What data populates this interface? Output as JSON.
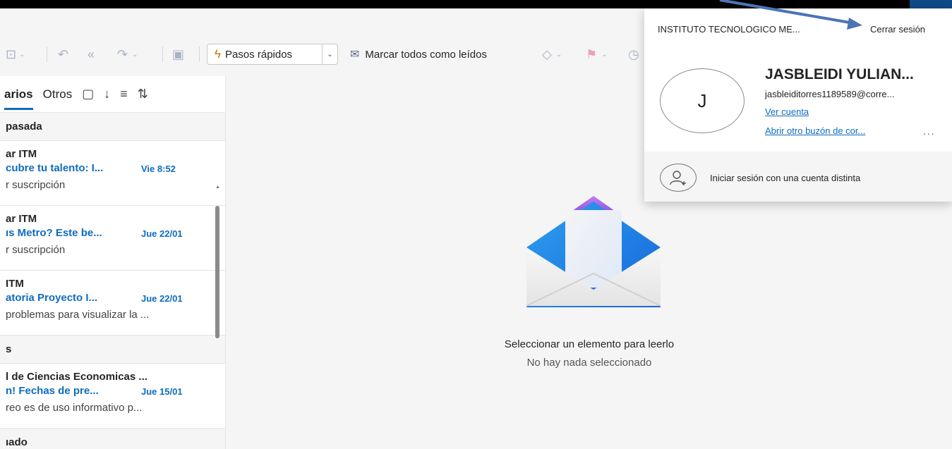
{
  "ribbon": {
    "quick_steps_label": "Pasos rápidos",
    "mark_all_read_label": "Marcar todos como leídos"
  },
  "message_list": {
    "tabs": {
      "focused": "arios",
      "other": "Otros"
    },
    "groups": [
      {
        "header": "pasada",
        "mails": [
          {
            "sender": "ar ITM",
            "subject": "cubre tu talento: I...",
            "date": "Vie 8:52",
            "preview": "r suscripción"
          },
          {
            "sender": "ar ITM",
            "subject": "ıs Metro? Este be...",
            "date": "Jue 22/01",
            "preview": "r suscripción"
          },
          {
            "sender": "ITM",
            "subject": "atoria Proyecto I...",
            "date": "Jue 22/01",
            "preview": "problemas para visualizar la ..."
          }
        ]
      },
      {
        "header": "s",
        "mails": [
          {
            "sender": "l de Ciencias Economicas ...",
            "subject": "n! Fechas de pre...",
            "date": "Jue 15/01",
            "preview": "reo es de uso informativo p..."
          }
        ]
      },
      {
        "header": "ıado",
        "mails": []
      }
    ]
  },
  "reading_pane": {
    "empty_title": "Seleccionar un elemento para leerlo",
    "empty_subtitle": "No hay nada seleccionado"
  },
  "account_popup": {
    "organization": "INSTITUTO TECNOLOGICO ME...",
    "sign_out": "Cerrar sesión",
    "avatar_initial": "J",
    "user_name": "JASBLEIDI YULIAN...",
    "email": "jasbleiditorres1189589@corre...",
    "view_account": "Ver cuenta",
    "open_other_mailbox": "Abrir otro buzón de cor...",
    "more_options": "...",
    "sign_in_other": "Iniciar sesión con una cuenta distinta"
  },
  "colors": {
    "accent": "#0f6cbd",
    "arrow": "#4a74b4"
  }
}
